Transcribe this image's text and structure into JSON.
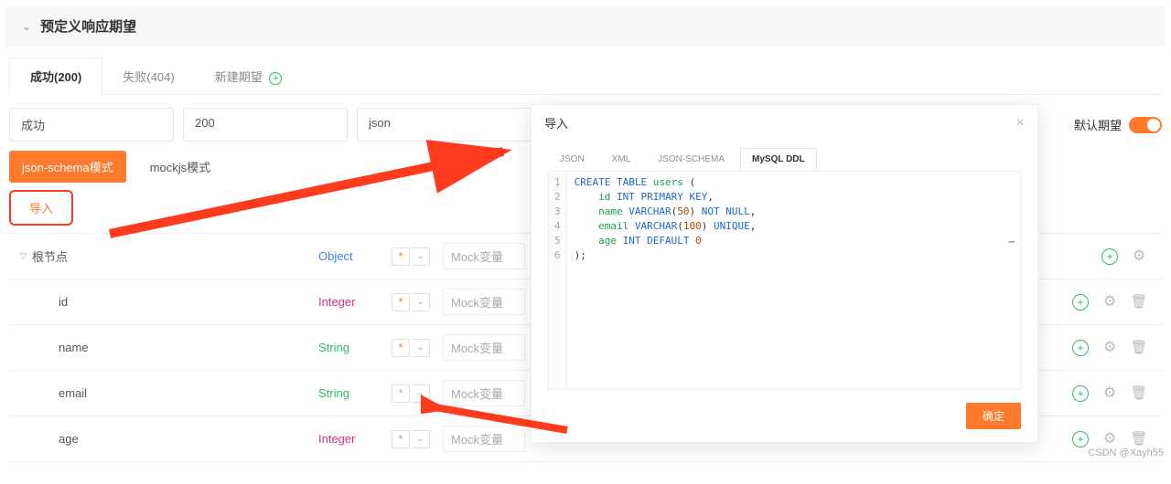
{
  "panel": {
    "title": "预定义响应期望"
  },
  "tabs": {
    "success": "成功(200)",
    "failure": "失败(404)",
    "add": "新建期望"
  },
  "inputs": {
    "name": "成功",
    "code": "200",
    "format": "json"
  },
  "toggle": {
    "label": "默认期望"
  },
  "modes": {
    "json_schema": "json-schema模式",
    "mockjs": "mockjs模式"
  },
  "import_btn": "导入",
  "mock_placeholder": "Mock变量",
  "rows": [
    {
      "name": "根节点",
      "type": "Object",
      "type_class": "t-object",
      "required": true,
      "root": true
    },
    {
      "name": "id",
      "type": "Integer",
      "type_class": "t-integer",
      "required": true,
      "root": false
    },
    {
      "name": "name",
      "type": "String",
      "type_class": "t-string",
      "required": true,
      "root": false
    },
    {
      "name": "email",
      "type": "String",
      "type_class": "t-string",
      "required": false,
      "root": false
    },
    {
      "name": "age",
      "type": "Integer",
      "type_class": "t-integer",
      "required": false,
      "root": false
    }
  ],
  "dialog": {
    "title": "导入",
    "tabs": {
      "json": "JSON",
      "xml": "XML",
      "json_schema": "JSON-SCHEMA",
      "mysql_ddl": "MySQL DDL"
    },
    "confirm": "确定",
    "code_lines": [
      "CREATE TABLE users (",
      "    id INT PRIMARY KEY,",
      "    name VARCHAR(50) NOT NULL,",
      "    email VARCHAR(100) UNIQUE,",
      "    age INT DEFAULT 0",
      ");"
    ]
  },
  "watermark": "CSDN @Xayh55"
}
